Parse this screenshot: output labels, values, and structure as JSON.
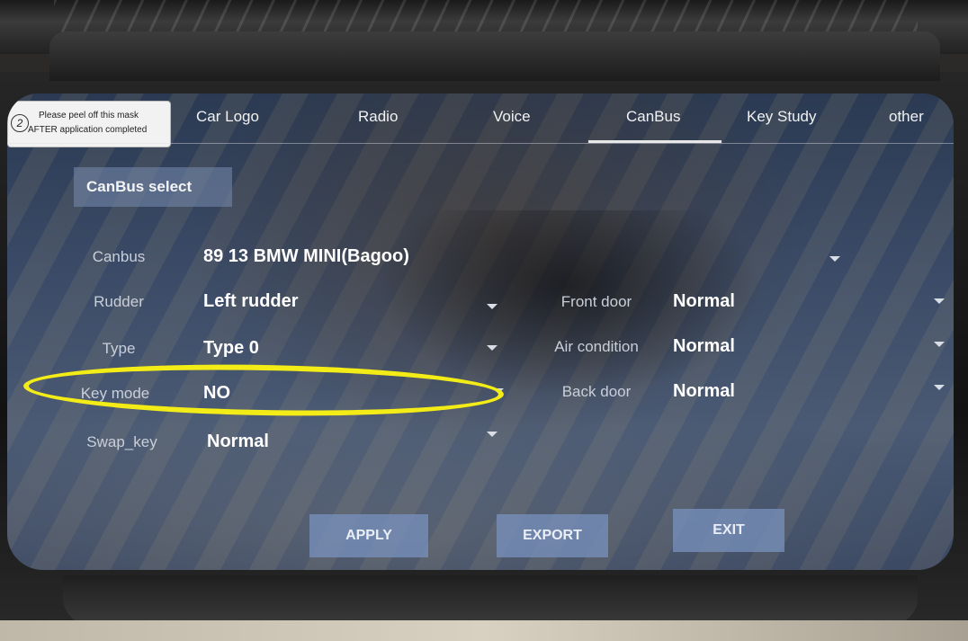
{
  "sticker": {
    "number": "2",
    "line1": "Please peel off this mask",
    "line2": "AFTER application completed"
  },
  "tabs": [
    {
      "label": "Car Logo"
    },
    {
      "label": "Radio"
    },
    {
      "label": "Voice"
    },
    {
      "label": "CanBus",
      "active": true
    },
    {
      "label": "Key Study"
    },
    {
      "label": "other"
    }
  ],
  "section": {
    "label": "CanBus select"
  },
  "fields": {
    "canbus": {
      "label": "Canbus",
      "value": "89 13 BMW MINI(Bagoo)"
    },
    "rudder": {
      "label": "Rudder",
      "value": "Left rudder"
    },
    "type": {
      "label": "Type",
      "value": "Type 0"
    },
    "key_mode": {
      "label": "Key mode",
      "value": "NO"
    },
    "swap_key": {
      "label": "Swap_key",
      "value": "Normal"
    },
    "front_door": {
      "label": "Front door",
      "value": "Normal"
    },
    "air_condition": {
      "label": "Air condition",
      "value": "Normal"
    },
    "back_door": {
      "label": "Back door",
      "value": "Normal"
    }
  },
  "buttons": {
    "apply": "APPLY",
    "export": "EXPORT",
    "exit": "EXIT"
  },
  "colors": {
    "highlight": "#f4ec16",
    "button": "#7891be",
    "screen": "#3a4a66"
  }
}
